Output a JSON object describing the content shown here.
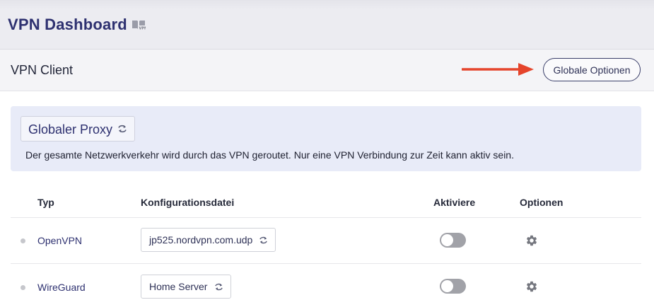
{
  "header": {
    "title": "VPN Dashboard",
    "icon": "vpn-book-icon"
  },
  "client_bar": {
    "title": "VPN Client",
    "global_options_button": "Globale Optionen",
    "annotation_arrow_color": "#e5442b"
  },
  "proxy": {
    "mode": "Globaler Proxy",
    "description": "Der gesamte Netzwerkverkehr wird durch das VPN geroutet. Nur eine VPN Verbindung zur Zeit kann aktiv sein."
  },
  "table": {
    "columns": [
      "Typ",
      "Konfigurationsdatei",
      "Aktiviere",
      "Optionen"
    ],
    "rows": [
      {
        "type": "OpenVPN",
        "config": "jp525.nordvpn.com.udp",
        "active": false,
        "status": "inactive"
      },
      {
        "type": "WireGuard",
        "config": "Home Server",
        "active": false,
        "status": "inactive"
      }
    ]
  },
  "colors": {
    "accent": "#2e3170",
    "proxy_bg": "#e8ebf8",
    "toggle_off": "#a1a2a8",
    "arrow": "#e5442b"
  }
}
